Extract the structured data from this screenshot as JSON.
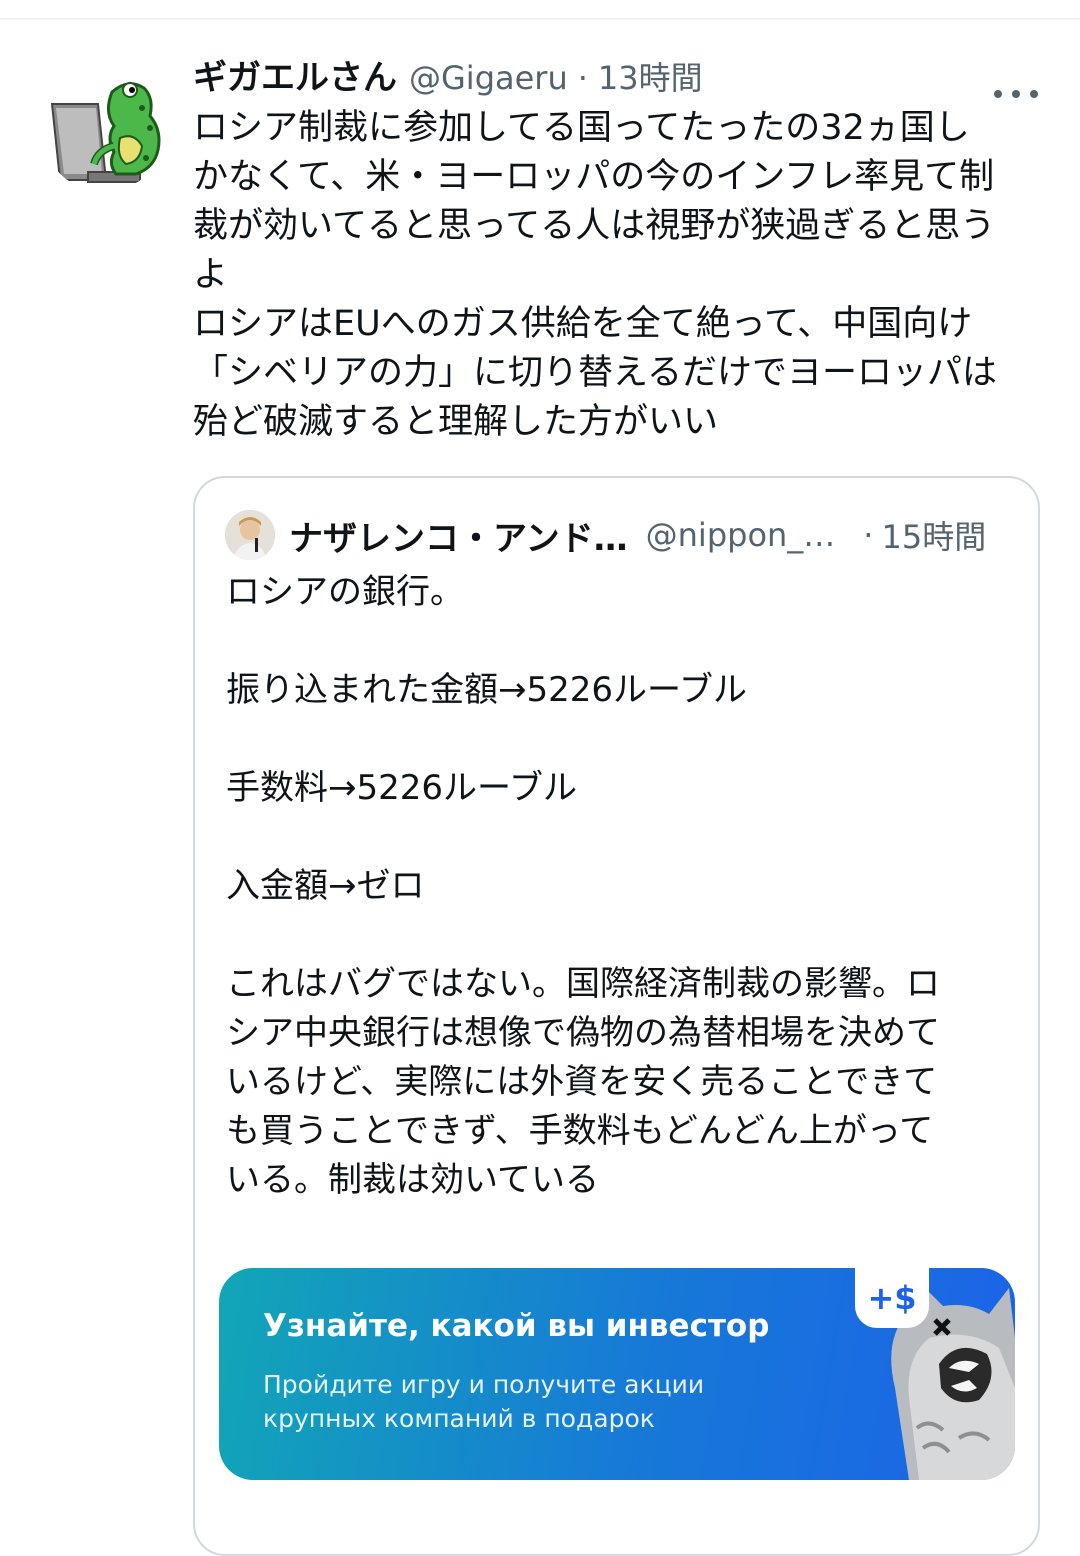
{
  "tweet": {
    "author_name": "ギガエルさん",
    "author_handle": "@Gigaeru",
    "separator": "·",
    "time": "13時間",
    "text": "ロシア制裁に参加してる国ってたったの32ヵ国し\nかなくて、米・ヨーロッパの今のインフレ率見て制\n裁が効いてると思ってる人は視野が狭過ぎると思う\nよ\nロシアはEUへのガス供給を全て絶って、中国向け\n「シベリアの力」に切り替えるだけでヨーロッパは\n殆ど破滅すると理解した方がいい"
  },
  "quote": {
    "author_name": "ナザレンコ・アンド…",
    "author_handle": "@nippon_…",
    "separator": "·",
    "time": "15時間",
    "text": "ロシアの銀行。\n\n振り込まれた金額→5226ルーブル\n\n手数料→5226ルーブル\n\n入金額→ゼロ\n\nこれはバグではない。国際経済制裁の影響。ロ\nシア中央銀行は想像で偽物の為替相場を決めて\nいるけど、実際には外資を安く売ることできて\nも買うことできず、手数料もどんどん上がって\nいる。制裁は効いている"
  },
  "ad": {
    "title": "Узнайте, какой вы инвестор",
    "subtitle": "Пройдите игру и получите акции\nкрупных компаний в подарок",
    "badge": "+$"
  },
  "icons": {
    "more": "more-horizontal-icon",
    "close": "close-icon"
  },
  "colors": {
    "text_primary": "#0f1419",
    "text_secondary": "#536471",
    "border": "#cfd9de",
    "ad_gradient_start": "#12a6b7",
    "ad_gradient_end": "#1c63e8"
  }
}
